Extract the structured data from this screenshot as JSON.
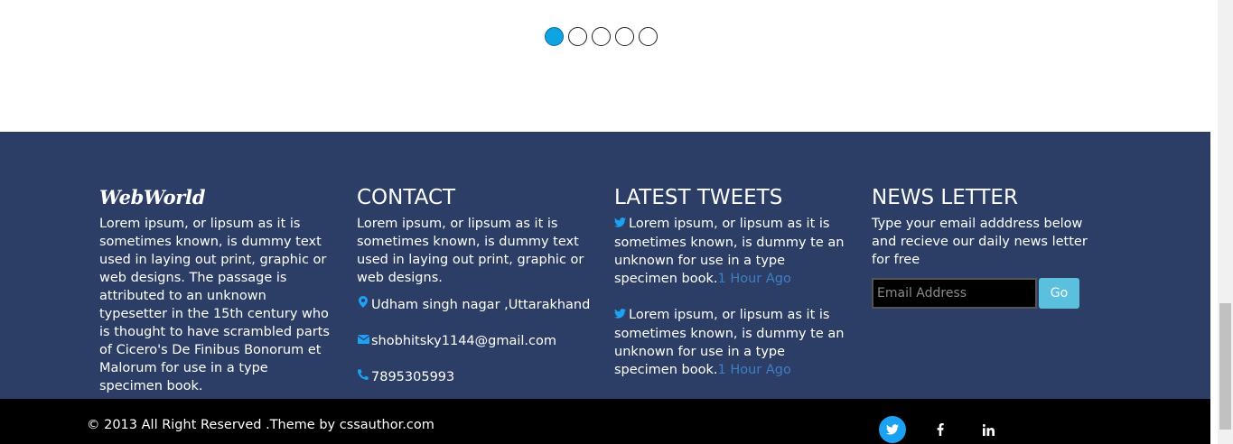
{
  "slider": {
    "dot_count": 5,
    "active_index": 0
  },
  "footer": {
    "brand": "WebWorld",
    "about": "Lorem ipsum, or lipsum as it is sometimes known, is dummy text used in laying out print, graphic or web designs. The passage is attributed to an unknown typesetter in the 15th century who is thought to have scrambled parts of Cicero's De Finibus Bonorum et Malorum for use in a type specimen book.",
    "contact": {
      "heading": "CONTACT",
      "text": "Lorem ipsum, or lipsum as it is sometimes known, is dummy text used in laying out print, graphic or web designs.",
      "address": "Udham singh nagar ,Uttarakhand",
      "email": "shobhitsky1144@gmail.com",
      "phone": "7895305993"
    },
    "tweets": {
      "heading": "LATEST TWEETS",
      "items": [
        {
          "text": "Lorem ipsum, or lipsum as it is sometimes known, is dummy te an unknown for use in a type specimen book.",
          "ago": "1 Hour Ago"
        },
        {
          "text": "Lorem ipsum, or lipsum as it is sometimes known, is dummy te an unknown for use in a type specimen book.",
          "ago": "1 Hour Ago"
        }
      ]
    },
    "newsletter": {
      "heading": "NEWS LETTER",
      "text": "Type your email adddress below and recieve our daily news letter for free",
      "placeholder": "Email Address",
      "button": "Go"
    }
  },
  "bottom": {
    "copyright": "© 2013 All Right Reserved .Theme by cssauthor.com",
    "social": [
      "twitter-icon",
      "facebook-icon",
      "linkedin-icon"
    ]
  },
  "colors": {
    "footer_bg": "#2c3e66",
    "accent": "#1da1f2",
    "button": "#5bc0de"
  }
}
